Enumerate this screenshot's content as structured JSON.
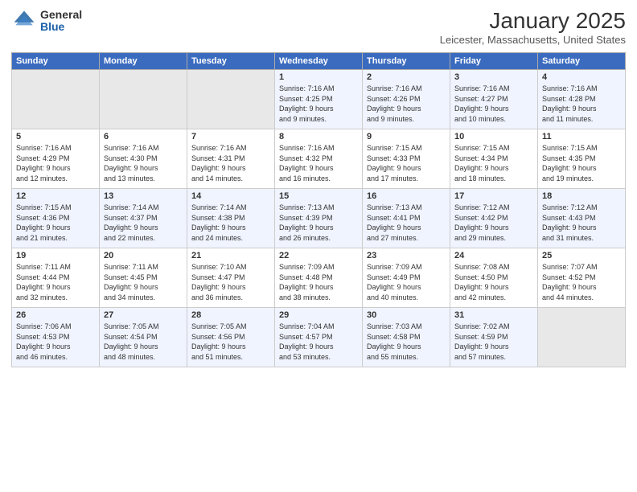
{
  "logo": {
    "general": "General",
    "blue": "Blue"
  },
  "title": "January 2025",
  "subtitle": "Leicester, Massachusetts, United States",
  "days_of_week": [
    "Sunday",
    "Monday",
    "Tuesday",
    "Wednesday",
    "Thursday",
    "Friday",
    "Saturday"
  ],
  "weeks": [
    [
      {
        "day": "",
        "content": ""
      },
      {
        "day": "",
        "content": ""
      },
      {
        "day": "",
        "content": ""
      },
      {
        "day": "1",
        "content": "Sunrise: 7:16 AM\nSunset: 4:25 PM\nDaylight: 9 hours\nand 9 minutes."
      },
      {
        "day": "2",
        "content": "Sunrise: 7:16 AM\nSunset: 4:26 PM\nDaylight: 9 hours\nand 9 minutes."
      },
      {
        "day": "3",
        "content": "Sunrise: 7:16 AM\nSunset: 4:27 PM\nDaylight: 9 hours\nand 10 minutes."
      },
      {
        "day": "4",
        "content": "Sunrise: 7:16 AM\nSunset: 4:28 PM\nDaylight: 9 hours\nand 11 minutes."
      }
    ],
    [
      {
        "day": "5",
        "content": "Sunrise: 7:16 AM\nSunset: 4:29 PM\nDaylight: 9 hours\nand 12 minutes."
      },
      {
        "day": "6",
        "content": "Sunrise: 7:16 AM\nSunset: 4:30 PM\nDaylight: 9 hours\nand 13 minutes."
      },
      {
        "day": "7",
        "content": "Sunrise: 7:16 AM\nSunset: 4:31 PM\nDaylight: 9 hours\nand 14 minutes."
      },
      {
        "day": "8",
        "content": "Sunrise: 7:16 AM\nSunset: 4:32 PM\nDaylight: 9 hours\nand 16 minutes."
      },
      {
        "day": "9",
        "content": "Sunrise: 7:15 AM\nSunset: 4:33 PM\nDaylight: 9 hours\nand 17 minutes."
      },
      {
        "day": "10",
        "content": "Sunrise: 7:15 AM\nSunset: 4:34 PM\nDaylight: 9 hours\nand 18 minutes."
      },
      {
        "day": "11",
        "content": "Sunrise: 7:15 AM\nSunset: 4:35 PM\nDaylight: 9 hours\nand 19 minutes."
      }
    ],
    [
      {
        "day": "12",
        "content": "Sunrise: 7:15 AM\nSunset: 4:36 PM\nDaylight: 9 hours\nand 21 minutes."
      },
      {
        "day": "13",
        "content": "Sunrise: 7:14 AM\nSunset: 4:37 PM\nDaylight: 9 hours\nand 22 minutes."
      },
      {
        "day": "14",
        "content": "Sunrise: 7:14 AM\nSunset: 4:38 PM\nDaylight: 9 hours\nand 24 minutes."
      },
      {
        "day": "15",
        "content": "Sunrise: 7:13 AM\nSunset: 4:39 PM\nDaylight: 9 hours\nand 26 minutes."
      },
      {
        "day": "16",
        "content": "Sunrise: 7:13 AM\nSunset: 4:41 PM\nDaylight: 9 hours\nand 27 minutes."
      },
      {
        "day": "17",
        "content": "Sunrise: 7:12 AM\nSunset: 4:42 PM\nDaylight: 9 hours\nand 29 minutes."
      },
      {
        "day": "18",
        "content": "Sunrise: 7:12 AM\nSunset: 4:43 PM\nDaylight: 9 hours\nand 31 minutes."
      }
    ],
    [
      {
        "day": "19",
        "content": "Sunrise: 7:11 AM\nSunset: 4:44 PM\nDaylight: 9 hours\nand 32 minutes."
      },
      {
        "day": "20",
        "content": "Sunrise: 7:11 AM\nSunset: 4:45 PM\nDaylight: 9 hours\nand 34 minutes."
      },
      {
        "day": "21",
        "content": "Sunrise: 7:10 AM\nSunset: 4:47 PM\nDaylight: 9 hours\nand 36 minutes."
      },
      {
        "day": "22",
        "content": "Sunrise: 7:09 AM\nSunset: 4:48 PM\nDaylight: 9 hours\nand 38 minutes."
      },
      {
        "day": "23",
        "content": "Sunrise: 7:09 AM\nSunset: 4:49 PM\nDaylight: 9 hours\nand 40 minutes."
      },
      {
        "day": "24",
        "content": "Sunrise: 7:08 AM\nSunset: 4:50 PM\nDaylight: 9 hours\nand 42 minutes."
      },
      {
        "day": "25",
        "content": "Sunrise: 7:07 AM\nSunset: 4:52 PM\nDaylight: 9 hours\nand 44 minutes."
      }
    ],
    [
      {
        "day": "26",
        "content": "Sunrise: 7:06 AM\nSunset: 4:53 PM\nDaylight: 9 hours\nand 46 minutes."
      },
      {
        "day": "27",
        "content": "Sunrise: 7:05 AM\nSunset: 4:54 PM\nDaylight: 9 hours\nand 48 minutes."
      },
      {
        "day": "28",
        "content": "Sunrise: 7:05 AM\nSunset: 4:56 PM\nDaylight: 9 hours\nand 51 minutes."
      },
      {
        "day": "29",
        "content": "Sunrise: 7:04 AM\nSunset: 4:57 PM\nDaylight: 9 hours\nand 53 minutes."
      },
      {
        "day": "30",
        "content": "Sunrise: 7:03 AM\nSunset: 4:58 PM\nDaylight: 9 hours\nand 55 minutes."
      },
      {
        "day": "31",
        "content": "Sunrise: 7:02 AM\nSunset: 4:59 PM\nDaylight: 9 hours\nand 57 minutes."
      },
      {
        "day": "",
        "content": ""
      }
    ]
  ]
}
